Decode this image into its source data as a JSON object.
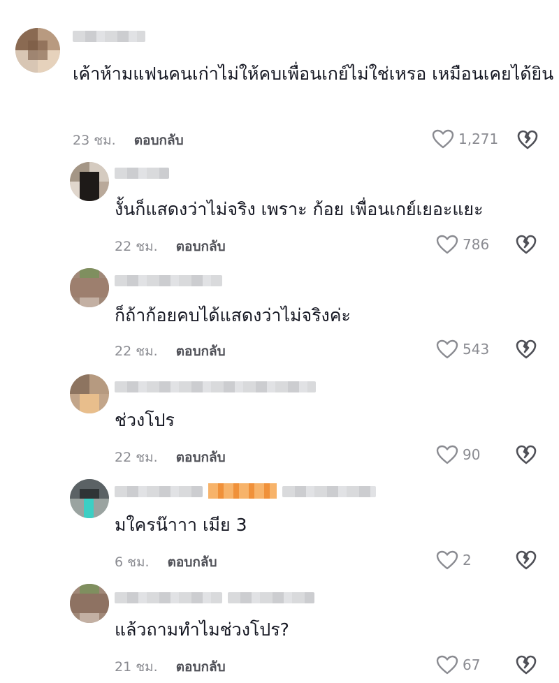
{
  "comments": [
    {
      "text": "เค้าห้ามแฟนคนเก่าไม่ให้คบเพื่อนเกย์ไม่ใช่เหรอ เหมือนเคยได้ยิน",
      "time": "23 ชม.",
      "reply": "ตอบกลับ",
      "likes": "1,271"
    },
    {
      "text": "งั้นก็แสดงว่าไม่จริง เพราะ ก้อย เพื่อนเกย์เยอะแยะ",
      "time": "22 ชม.",
      "reply": "ตอบกลับ",
      "likes": "786"
    },
    {
      "text": "ก็ถ้าก้อยคบได้แสดงว่าไม่จริงค่ะ",
      "time": "22 ชม.",
      "reply": "ตอบกลับ",
      "likes": "543"
    },
    {
      "text": "ช่วงโปร",
      "time": "22 ชม.",
      "reply": "ตอบกลับ",
      "likes": "90"
    },
    {
      "text": "มใครน๊าาา เมีย 3",
      "time": "6 ชม.",
      "reply": "ตอบกลับ",
      "likes": "2"
    },
    {
      "text": "แล้วถามทำไมช่วงโปร?",
      "time": "21 ชม.",
      "reply": "ตอบกลับ",
      "likes": "67"
    }
  ],
  "icons": {
    "like": "heart-outline-icon",
    "dislike": "broken-heart-icon"
  },
  "colors": {
    "text": "#161823",
    "meta": "#8a8b91",
    "badge": "#f5a24a"
  }
}
